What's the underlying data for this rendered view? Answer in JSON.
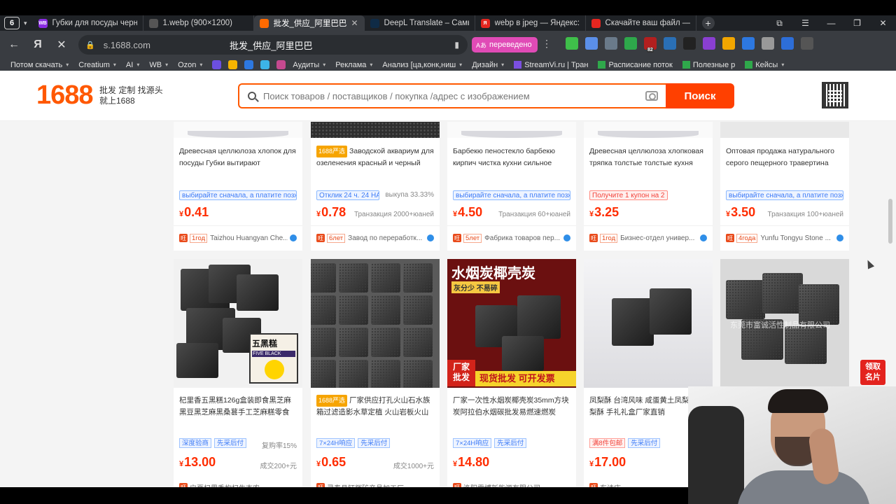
{
  "browser": {
    "tab_count": "6",
    "tabs": [
      {
        "label": "Губки для посуды черны",
        "fav_color": "#8a2be2",
        "fav_text": "WB",
        "active": false
      },
      {
        "label": "1.webp (900×1200)",
        "fav_color": "#555555",
        "fav_text": "",
        "active": false
      },
      {
        "label": "批发_供应_阿里巴巴",
        "fav_color": "#ff6a00",
        "fav_text": "",
        "active": true
      },
      {
        "label": "DeepL Translate – Самый",
        "fav_color": "#0f2b46",
        "fav_text": "",
        "active": false
      },
      {
        "label": "webp в jpeg — Яндекс: н",
        "fav_color": "#e52620",
        "fav_text": "Я",
        "active": false
      },
      {
        "label": "Скачайте ваш файл — С",
        "fav_color": "#e52620",
        "fav_text": "",
        "active": false
      }
    ],
    "address": {
      "url": "s.1688.com",
      "page_title": "批发_供应_阿里巴巴",
      "translated_label": "переведено"
    },
    "bookmarks": [
      {
        "label": "Потом скачать",
        "dropdown": true
      },
      {
        "label": "Creatium",
        "dropdown": true
      },
      {
        "label": "AI",
        "dropdown": true
      },
      {
        "label": "WB",
        "dropdown": true
      },
      {
        "label": "Ozon",
        "dropdown": true
      },
      {
        "label": "Аудиты",
        "dropdown": true
      },
      {
        "label": "Реклама",
        "dropdown": true
      },
      {
        "label": "Анализ [ца,конк,ниш",
        "dropdown": true
      },
      {
        "label": "Дизайн",
        "dropdown": true
      },
      {
        "label": "StreamVi.ru | Тран",
        "dropdown": false
      },
      {
        "label": "Расписание поток",
        "dropdown": false
      },
      {
        "label": "Полезные р",
        "dropdown": false
      },
      {
        "label": "Кейсы",
        "dropdown": true
      }
    ],
    "extensions": [
      {
        "name": "puzzle-icon",
        "color": "#3fbf4a"
      },
      {
        "name": "doc-icon",
        "color": "#5b8fe8"
      },
      {
        "name": "shield-icon",
        "color": "#6a7a8a"
      },
      {
        "name": "play-icon",
        "color": "#2ea84b"
      },
      {
        "name": "badge-icon",
        "color": "#b21f1f"
      },
      {
        "name": "box-icon",
        "color": "#2a6fb5"
      },
      {
        "name": "ring-icon",
        "color": "#222222"
      },
      {
        "name": "g-icon",
        "color": "#8a3fd1"
      },
      {
        "name": "mk-icon",
        "color": "#f2a600"
      },
      {
        "name": "download-icon",
        "color": "#2d78e0"
      },
      {
        "name": "chat-icon",
        "color": "#999999"
      },
      {
        "name": "translate-icon",
        "color": "#2d6ed8"
      },
      {
        "name": "down-icon",
        "color": "#555555"
      }
    ],
    "ext_badge": "82"
  },
  "site": {
    "logo_number": "1688",
    "logo_tagline_1": "批发 定制 找源头",
    "logo_tagline_2": "就上1688",
    "search_placeholder": "Поиск товаров / поставщиков / покупка /адрес с изображением",
    "search_button": "Поиск"
  },
  "row1": [
    {
      "title": "Древесная целлюлоза хлопок для посуды Губки вытирают",
      "badge": "",
      "promo": "выбирайте сначала, а платите позже",
      "promo_style": "blue",
      "promo_right": "",
      "price": "0.41",
      "deal": "",
      "years": "1год",
      "seller": "Taizhou Huangyan Che..."
    },
    {
      "title": "Заводской аквариум для озеленения красный и черный",
      "badge": "1688严选",
      "promo": "Отклик 24 ч. 24 HAGA",
      "promo_style": "blue",
      "promo_right": "выкупа 33.33%",
      "price": "0.78",
      "deal": "Транзакция 2000+юаней",
      "years": "6лет",
      "seller": "Завод по переработк..."
    },
    {
      "title": "Барбекю пеностекло барбекю кирпич чистка кухни сильное",
      "badge": "",
      "promo": "выбирайте сначала, а платите позже",
      "promo_style": "blue",
      "promo_right": "",
      "price": "4.50",
      "deal": "Транзакция 60+юаней",
      "years": "5лет",
      "seller": "Фабрика товаров пер..."
    },
    {
      "title": "Древесная целлюлоза хлопковая тряпка толстые толстые кухня",
      "badge": "",
      "promo": "Получите 1 купон на 2",
      "promo_style": "red",
      "promo_right": "",
      "price": "3.25",
      "deal": "",
      "years": "1год",
      "seller": "Бизнес-отдел универ..."
    },
    {
      "title": "Оптовая продажа натурального серого пещерного травертина",
      "badge": "",
      "promo": "выбирайте сначала, а платите позже",
      "promo_style": "blue",
      "promo_right": "",
      "price": "3.50",
      "deal": "Транзакция 100+юаней",
      "years": "4года",
      "seller": "Yunfu Tongyu Stone ..."
    }
  ],
  "row2": [
    {
      "title": "杞里香五黑糕126g盒装即食黑芝麻黑豆黑芝麻黑桑葚手工芝麻糕零食",
      "badge": "",
      "tags": [
        "深度验商",
        "先采后付"
      ],
      "tag_styles": [
        "blue",
        "blue"
      ],
      "right": "复购率15%",
      "price": "13.00",
      "deal": "成交200+元",
      "img_label": "五黑糕",
      "img_sub": "FIVE BLACK"
    },
    {
      "title": "厂家供应打孔火山石水族箱过滤造影水草定植 火山岩板火山石",
      "badge": "1688严选",
      "tags": [
        "7×24H响应",
        "先采后付"
      ],
      "tag_styles": [
        "blue",
        "blue"
      ],
      "right": "",
      "price": "0.65",
      "deal": "成交1000+元",
      "img_label": "",
      "img_sub": ""
    },
    {
      "title": "厂家一次性水烟炭椰壳炭35mm方块炭阿拉伯水烟碳批发易燃速燃炭",
      "badge": "",
      "tags": [
        "7×24H响应",
        "先采后付"
      ],
      "tag_styles": [
        "blue",
        "blue"
      ],
      "right": "",
      "price": "14.80",
      "deal": "",
      "img_label": "水烟炭椰壳炭",
      "img_sub": "灰分少 不易碎",
      "img_banner_1": "厂家",
      "img_banner_2": "批发",
      "img_banner_3": "现货批发 可开发票"
    },
    {
      "title": "凤梨酥 台湾风味 咸蛋黄土凤梨酥 凤梨酥 手礼礼盒厂家直销",
      "badge": "",
      "tags": [
        "满8件包邮",
        "先采后付"
      ],
      "tag_styles": [
        "red",
        "blue"
      ],
      "right": "",
      "price": "17.00",
      "deal": "",
      "img_label": "",
      "img_sub": ""
    },
    {
      "title": "",
      "badge": "",
      "tags": [],
      "tag_styles": [],
      "right": "",
      "price": "",
      "deal": "",
      "img_label": "东莞市富诚活性制品有限公司",
      "img_sub": ""
    }
  ],
  "row2_sellers_partial": [
    "宁夏杞里香枸杞生态农",
    "灵寿县钰辉矿产品加工厂",
    "洛阳雷博新能源有限公司",
    "东诗庆"
  ],
  "float_tag": {
    "line1": "领取",
    "line2": "名片"
  },
  "currency_symbol": "¥"
}
